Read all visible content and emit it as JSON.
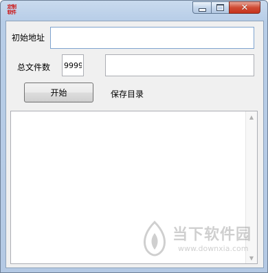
{
  "window": {
    "icon_text_line1": "定制",
    "icon_text_line2": "软件"
  },
  "form": {
    "start_address_label": "初始地址",
    "start_address_value": "",
    "total_files_label": "总文件数",
    "total_files_value": "9999",
    "save_dir_value": "",
    "start_button": "开始",
    "save_dir_label": "保存目录"
  },
  "output": {
    "text": ""
  },
  "watermark": {
    "brand": "当下软件园",
    "url": "www.downxia.com"
  },
  "colors": {
    "titlebar": "#b9cfe8",
    "close_button": "#c7331d",
    "client_bg": "#f0f0f0"
  },
  "icons": [
    "app-icon",
    "minimize-icon",
    "maximize-icon",
    "close-icon",
    "scroll-up-icon",
    "scroll-down-icon",
    "watermark-logo-icon"
  ]
}
